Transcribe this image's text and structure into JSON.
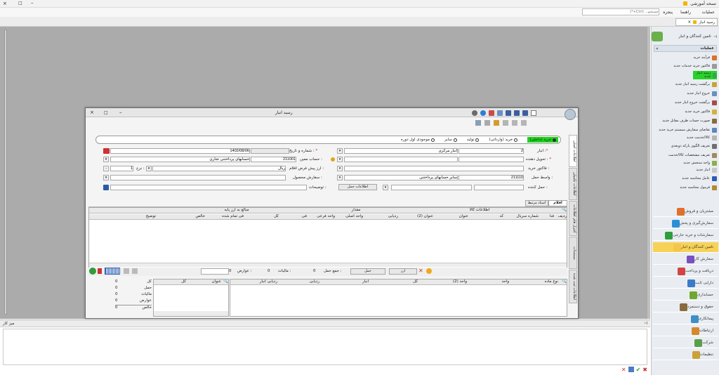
{
  "app": {
    "title": "نسخه آموزشی",
    "min": "–",
    "max": "□",
    "close": "×"
  },
  "menu": {
    "items": [
      "عملیات",
      "راهنما",
      "پنجره"
    ],
    "search_placeholder": "جستجو... (Ctrl+*)"
  },
  "doc_tab": {
    "label": "رسید انبار",
    "close": "×"
  },
  "side": {
    "header": "تامین کنندگان و انبار",
    "ops_title": "عملیات",
    "ops": [
      "فرآیند خرید",
      "فاکتور خرید خدمات جدید",
      "رسید انبار جدید",
      "برگشت رسید انبار جدید",
      "خروج انبار جدید",
      "برگشت خروج انبار جدید",
      "فاکتور خرید جدید",
      "صورت حساب طرف مقابل جدید",
      "تقاضای سفارش سیستم خرید جدید",
      "کالا/خدمت جدید",
      "تعریف الگوی بارکد دوبعدی",
      "تعریف مشخصات کالا/خدمت",
      "واحد سنجش جدید",
      "انبار جدید",
      "عامل محاسبه جدید",
      "فرمول محاسبه جدید"
    ],
    "nav": [
      "مشتریان و فروش",
      "سفارش‌گیری و پخش",
      "سفارشات و خرید خارجی",
      "تامین کنندگان و انبار",
      "سفارش کار",
      "دریافت و پرداخت",
      "دارایی ثابت",
      "حسابداری",
      "حقوق و دستمزد",
      "پیمانکاری",
      "ارتباطات",
      "شرکت",
      "تنظیمات"
    ],
    "colors": [
      "#e26f2a",
      "#2a8fd6",
      "#2e9d3a",
      "#f5c64a",
      "#7a4fbf",
      "#d24545",
      "#3a7cc9",
      "#6fa82f",
      "#8a6b3f",
      "#3d8fc7",
      "#d48a2a",
      "#5a9e4b",
      "#c9a23a"
    ]
  },
  "dialog": {
    "title": "رسید انبار",
    "radios": [
      "خرید (داخلی)",
      "خرید (وارداتی)",
      "تولید",
      "سایر",
      "موجودی اول دوره"
    ],
    "fields": {
      "anbar_label": "انبار :",
      "anbar_code": "2",
      "anbar_name": "انبار مرکزی",
      "number_date_label": "شماره و تاریخ :",
      "date": "1402/08/06",
      "deliverer_label": "تحویل دهنده :",
      "account_label": "حساب معین :",
      "account_code": "211001",
      "account_name": "حسابهای پرداختنی تجاری",
      "invoice_label": "فاکتور خرید :",
      "currency_label": "ارز پیش فرض اقلام :",
      "currency": "ریال",
      "rate_label": "نرخ :",
      "rate": "1",
      "intermediary_label": "واسط حمل :",
      "intermediary_code": "211110",
      "intermediary_name": "سایر حسابهای پرداختنی",
      "product_order_label": "سفارش محصول :",
      "carrier_label": "حمل کننده :",
      "notes_label": "توضیحات :",
      "shipping_btn": "اطلاعات حمل"
    },
    "vtabs": [
      "اطلاعات اصلی",
      "اطلاعات تکمیلی",
      "کنترل های اطلاعات",
      "مستندات",
      "اطلاعات ثبت شده"
    ],
    "subtabs": [
      "اقلام",
      "اسناد مرتبط"
    ],
    "grid_groups": [
      "اطلاعات کالا",
      "مقدار",
      "مبالغ به ارز پایه"
    ],
    "grid_cols": [
      "ردیف",
      "فنا",
      "شماره سریال",
      "کد",
      "عنوان",
      "عنوان (2)",
      "ردیابی",
      "واحد اصلی",
      "واحد فرعی",
      "فی",
      "کل",
      "فی تمام شده",
      "خالص",
      "توضیح"
    ],
    "footer": {
      "tax_label": "مالیات :",
      "tax": "0",
      "duty_label": "عوارض :",
      "duty": "0",
      "ship_total_label": "جمع حمل :",
      "ship_total": "0",
      "btn_ship": "حمل",
      "btn_ars": "ارز"
    },
    "lower_cols": [
      "نوع ماده",
      "واحد",
      "واحد (2)",
      "کل",
      "انبار",
      "ردیابی",
      "ردیابی انبار"
    ],
    "summary_cols": [
      "عنوان",
      "کل"
    ],
    "summary_rows": [
      {
        "k": "کل",
        "v": "0"
      },
      {
        "k": "حمل",
        "v": "0"
      },
      {
        "k": "مالیات",
        "v": "0"
      },
      {
        "k": "عوارض",
        "v": "0"
      },
      {
        "k": "خالص",
        "v": "0"
      }
    ]
  },
  "bottom": {
    "title": "میز کار"
  }
}
